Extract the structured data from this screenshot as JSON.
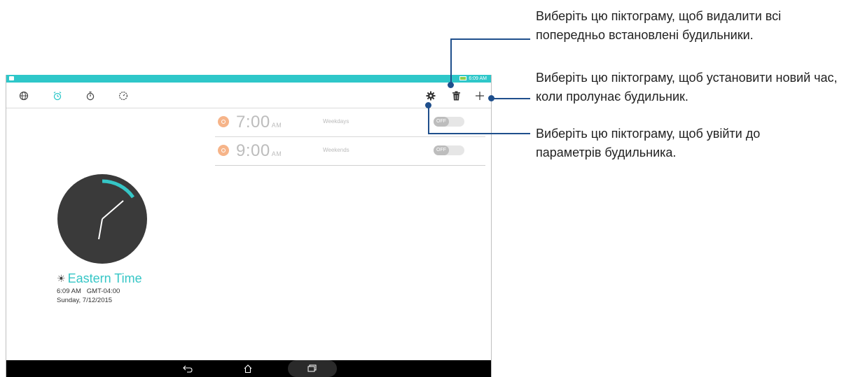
{
  "status_bar": {
    "time": "6:09 AM"
  },
  "tabs": [
    {
      "name": "world-clock",
      "icon": "globe-icon"
    },
    {
      "name": "alarm",
      "icon": "alarm-clock-icon"
    },
    {
      "name": "stopwatch",
      "icon": "stopwatch-icon"
    },
    {
      "name": "timer",
      "icon": "timer-icon"
    }
  ],
  "actions": {
    "settings_icon": "gear-icon",
    "delete_icon": "trash-icon",
    "add_icon": "plus-icon"
  },
  "alarms": [
    {
      "time": "7:00",
      "ampm": "AM",
      "days": "Weekdays",
      "toggle": "OFF"
    },
    {
      "time": "9:00",
      "ampm": "AM",
      "days": "Weekends",
      "toggle": "OFF"
    }
  ],
  "world_clock": {
    "city": "Eastern Time",
    "time_line": "6:09 AM   GMT-04:00",
    "date_line": "Sunday, 7/12/2015"
  },
  "callouts": {
    "delete": "Виберіть цю піктограму, щоб видалити всі попередньо встановлені будильники.",
    "add": "Виберіть цю піктограму, щоб установити новий час, коли пролунає будильник.",
    "settings": "Виберіть цю піктограму, щоб увійти до параметрів будильника."
  },
  "colors": {
    "accent": "#2ec7c9",
    "alarm_icon": "#f6b489",
    "callout_line": "#1f4f8c",
    "clock_face": "#3a3a3a"
  }
}
